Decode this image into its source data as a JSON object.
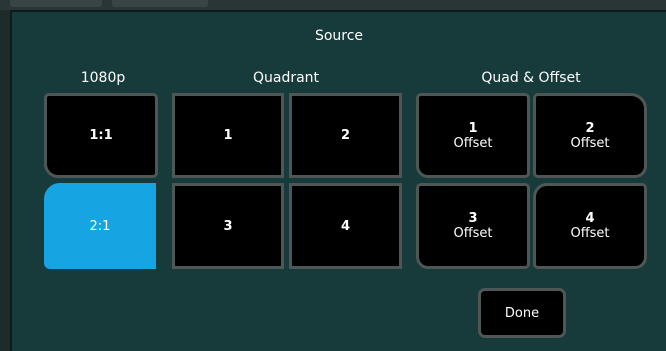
{
  "dialog": {
    "title": "Source"
  },
  "sections": {
    "p1080": {
      "label": "1080p"
    },
    "quadrant": {
      "label": "Quadrant"
    },
    "quad_offset": {
      "label": "Quad & Offset"
    }
  },
  "buttons": {
    "ratio_1_1": {
      "label": "1:1"
    },
    "ratio_2_1": {
      "label": "2:1",
      "state": "selected"
    },
    "quad_1": {
      "label": "1"
    },
    "quad_2": {
      "label": "2"
    },
    "quad_3": {
      "label": "3"
    },
    "quad_4": {
      "label": "4"
    },
    "offset_1": {
      "line1": "1",
      "line2": "Offset"
    },
    "offset_2": {
      "line1": "2",
      "line2": "Offset"
    },
    "offset_3": {
      "line1": "3",
      "line2": "Offset"
    },
    "offset_4": {
      "line1": "4",
      "line2": "Offset"
    },
    "done": {
      "label": "Done"
    }
  },
  "colors": {
    "dialog_bg": "#173b3a",
    "button_bg": "#000000",
    "button_border": "#4f5656",
    "selected": "#16a4e2"
  }
}
